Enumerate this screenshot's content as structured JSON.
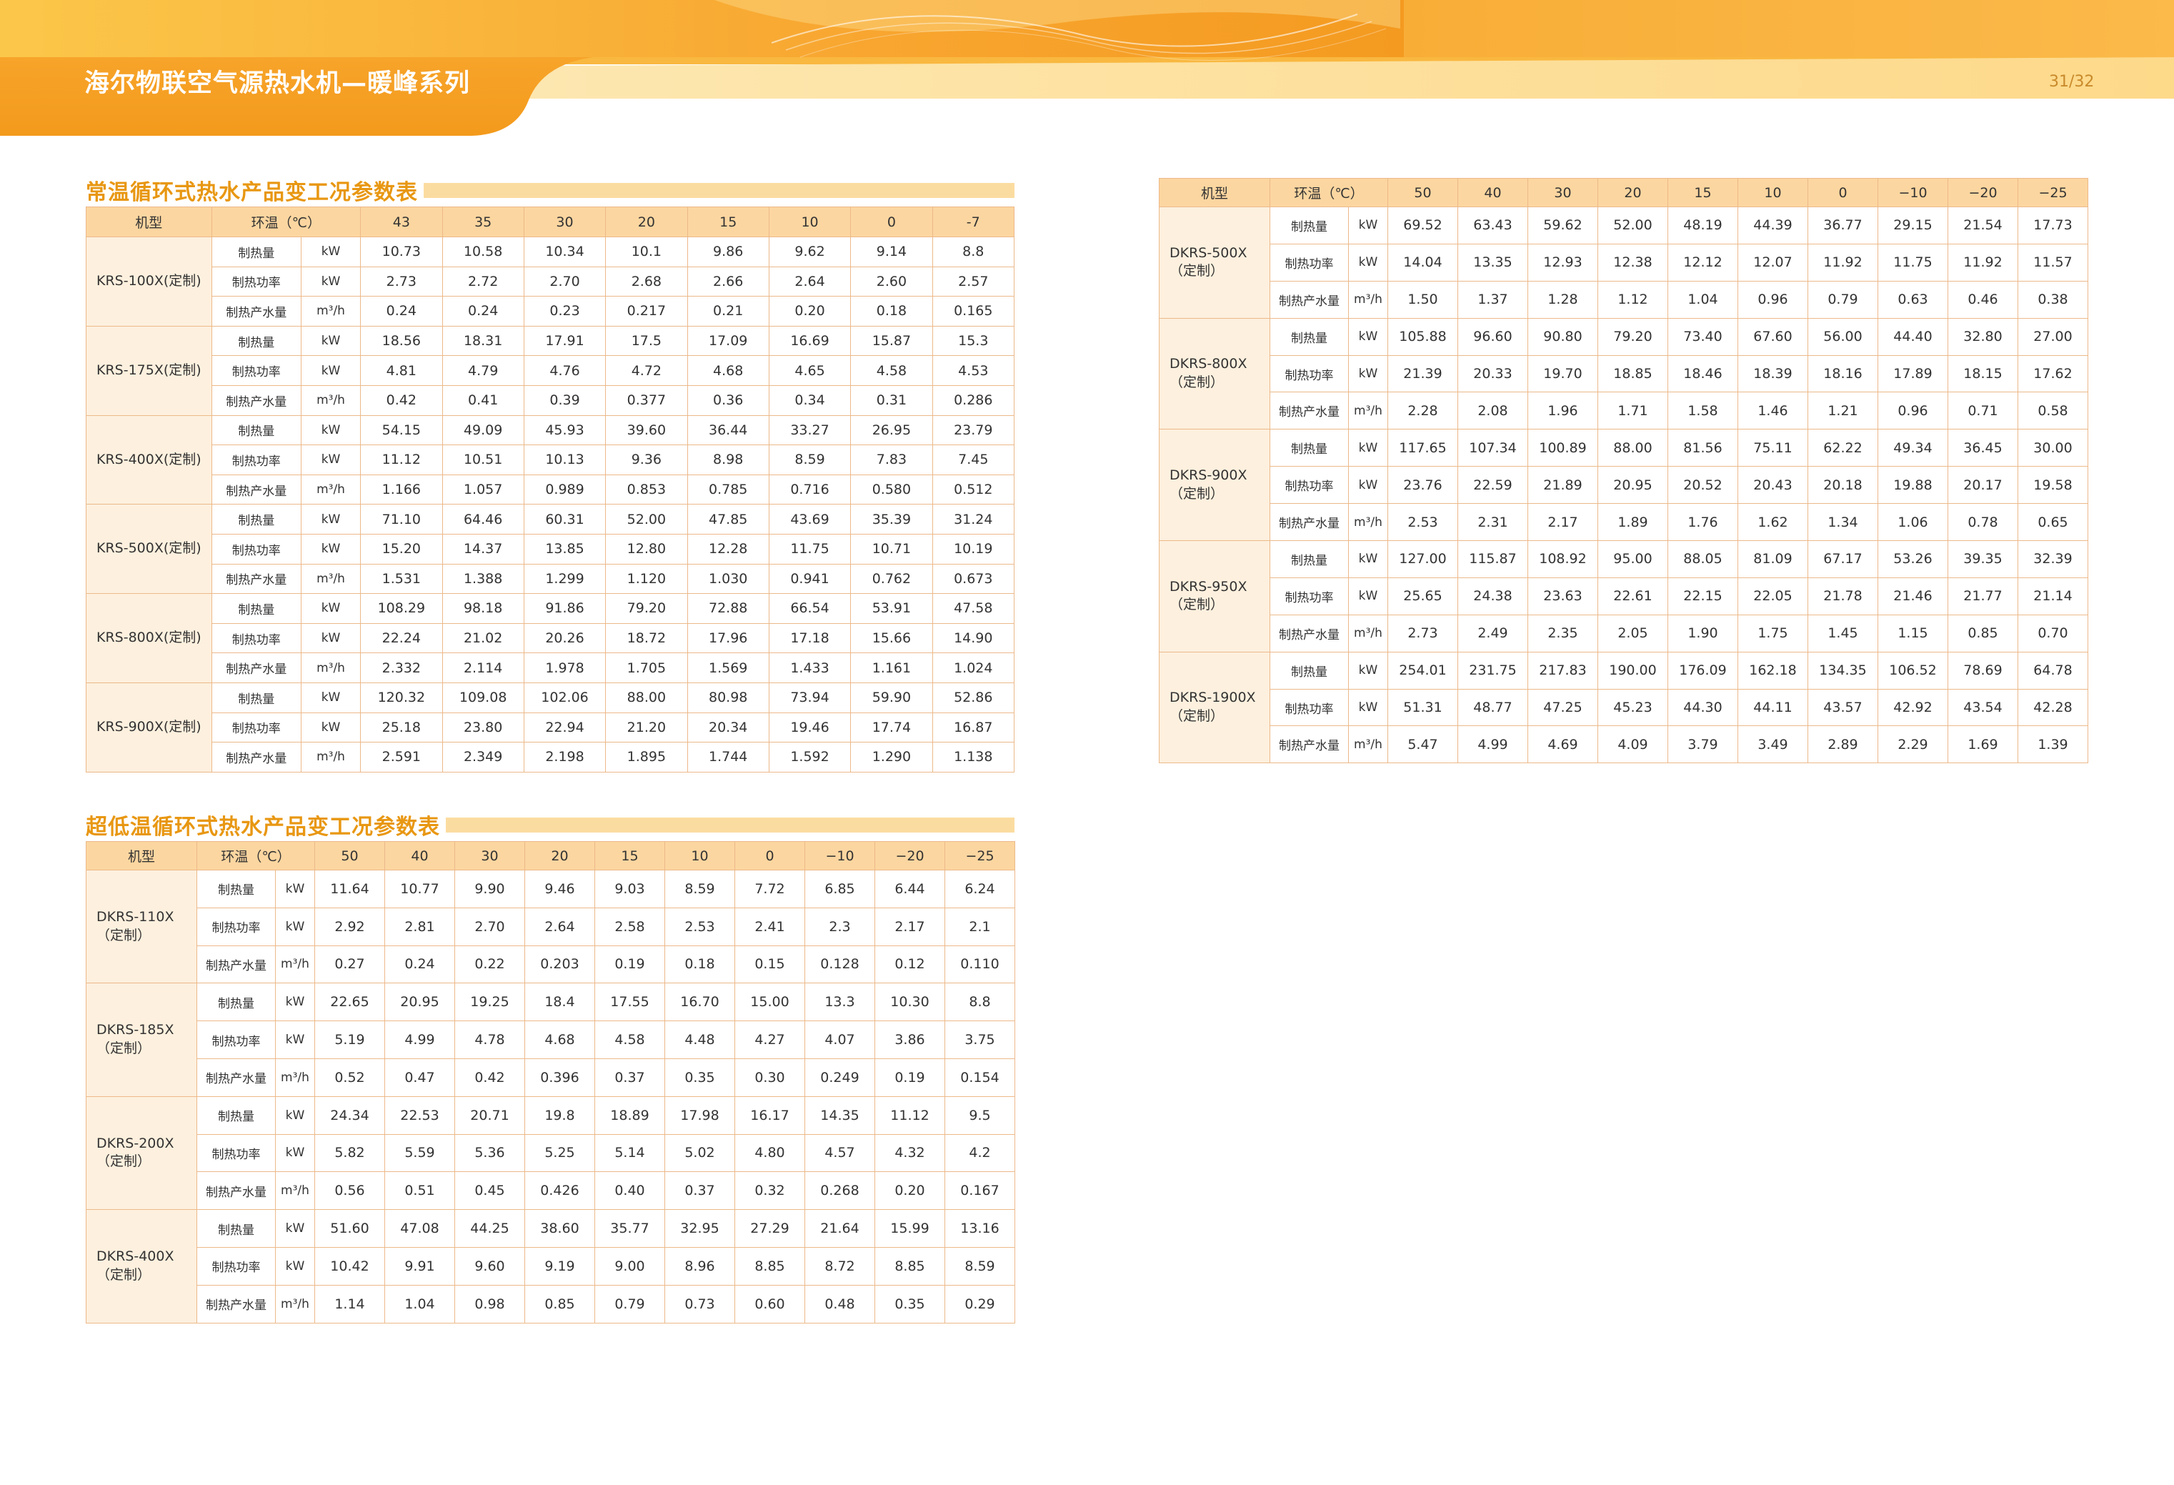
{
  "header": {
    "title": "海尔物联空气源热水机—暖峰系列",
    "page_number": "31/32"
  },
  "sections": {
    "normal_title": "常温循环式热水产品变工况参数表",
    "low_title": "超低温循环式热水产品变工况参数表"
  },
  "tables": {
    "normal": {
      "header_model": "机型",
      "header_ambient": "环温（℃）",
      "temps": [
        "43",
        "35",
        "30",
        "20",
        "15",
        "10",
        "0",
        "-7"
      ],
      "models": [
        {
          "name": "KRS-100X(定制)",
          "rows": [
            {
              "param": "制热量",
              "unit": "kW",
              "values": [
                "10.73",
                "10.58",
                "10.34",
                "10.1",
                "9.86",
                "9.62",
                "9.14",
                "8.8"
              ]
            },
            {
              "param": "制热功率",
              "unit": "kW",
              "values": [
                "2.73",
                "2.72",
                "2.70",
                "2.68",
                "2.66",
                "2.64",
                "2.60",
                "2.57"
              ]
            },
            {
              "param": "制热产水量",
              "unit": "m³/h",
              "values": [
                "0.24",
                "0.24",
                "0.23",
                "0.217",
                "0.21",
                "0.20",
                "0.18",
                "0.165"
              ]
            }
          ]
        },
        {
          "name": "KRS-175X(定制)",
          "rows": [
            {
              "param": "制热量",
              "unit": "kW",
              "values": [
                "18.56",
                "18.31",
                "17.91",
                "17.5",
                "17.09",
                "16.69",
                "15.87",
                "15.3"
              ]
            },
            {
              "param": "制热功率",
              "unit": "kW",
              "values": [
                "4.81",
                "4.79",
                "4.76",
                "4.72",
                "4.68",
                "4.65",
                "4.58",
                "4.53"
              ]
            },
            {
              "param": "制热产水量",
              "unit": "m³/h",
              "values": [
                "0.42",
                "0.41",
                "0.39",
                "0.377",
                "0.36",
                "0.34",
                "0.31",
                "0.286"
              ]
            }
          ]
        },
        {
          "name": "KRS-400X(定制)",
          "rows": [
            {
              "param": "制热量",
              "unit": "kW",
              "values": [
                "54.15",
                "49.09",
                "45.93",
                "39.60",
                "36.44",
                "33.27",
                "26.95",
                "23.79"
              ]
            },
            {
              "param": "制热功率",
              "unit": "kW",
              "values": [
                "11.12",
                "10.51",
                "10.13",
                "9.36",
                "8.98",
                "8.59",
                "7.83",
                "7.45"
              ]
            },
            {
              "param": "制热产水量",
              "unit": "m³/h",
              "values": [
                "1.166",
                "1.057",
                "0.989",
                "0.853",
                "0.785",
                "0.716",
                "0.580",
                "0.512"
              ]
            }
          ]
        },
        {
          "name": "KRS-500X(定制)",
          "rows": [
            {
              "param": "制热量",
              "unit": "kW",
              "values": [
                "71.10",
                "64.46",
                "60.31",
                "52.00",
                "47.85",
                "43.69",
                "35.39",
                "31.24"
              ]
            },
            {
              "param": "制热功率",
              "unit": "kW",
              "values": [
                "15.20",
                "14.37",
                "13.85",
                "12.80",
                "12.28",
                "11.75",
                "10.71",
                "10.19"
              ]
            },
            {
              "param": "制热产水量",
              "unit": "m³/h",
              "values": [
                "1.531",
                "1.388",
                "1.299",
                "1.120",
                "1.030",
                "0.941",
                "0.762",
                "0.673"
              ]
            }
          ]
        },
        {
          "name": "KRS-800X(定制)",
          "rows": [
            {
              "param": "制热量",
              "unit": "kW",
              "values": [
                "108.29",
                "98.18",
                "91.86",
                "79.20",
                "72.88",
                "66.54",
                "53.91",
                "47.58"
              ]
            },
            {
              "param": "制热功率",
              "unit": "kW",
              "values": [
                "22.24",
                "21.02",
                "20.26",
                "18.72",
                "17.96",
                "17.18",
                "15.66",
                "14.90"
              ]
            },
            {
              "param": "制热产水量",
              "unit": "m³/h",
              "values": [
                "2.332",
                "2.114",
                "1.978",
                "1.705",
                "1.569",
                "1.433",
                "1.161",
                "1.024"
              ]
            }
          ]
        },
        {
          "name": "KRS-900X(定制)",
          "rows": [
            {
              "param": "制热量",
              "unit": "kW",
              "values": [
                "120.32",
                "109.08",
                "102.06",
                "88.00",
                "80.98",
                "73.94",
                "59.90",
                "52.86"
              ]
            },
            {
              "param": "制热功率",
              "unit": "kW",
              "values": [
                "25.18",
                "23.80",
                "22.94",
                "21.20",
                "20.34",
                "19.46",
                "17.74",
                "16.87"
              ]
            },
            {
              "param": "制热产水量",
              "unit": "m³/h",
              "values": [
                "2.591",
                "2.349",
                "2.198",
                "1.895",
                "1.744",
                "1.592",
                "1.290",
                "1.138"
              ]
            }
          ]
        }
      ]
    },
    "low_left": {
      "header_model": "机型",
      "header_ambient": "环温（℃）",
      "temps": [
        "50",
        "40",
        "30",
        "20",
        "15",
        "10",
        "0",
        "−10",
        "−20",
        "−25"
      ],
      "models": [
        {
          "name": "DKRS-110X（定制）",
          "rows": [
            {
              "param": "制热量",
              "unit": "kW",
              "values": [
                "11.64",
                "10.77",
                "9.90",
                "9.46",
                "9.03",
                "8.59",
                "7.72",
                "6.85",
                "6.44",
                "6.24"
              ]
            },
            {
              "param": "制热功率",
              "unit": "kW",
              "values": [
                "2.92",
                "2.81",
                "2.70",
                "2.64",
                "2.58",
                "2.53",
                "2.41",
                "2.3",
                "2.17",
                "2.1"
              ]
            },
            {
              "param": "制热产水量",
              "unit": "m³/h",
              "values": [
                "0.27",
                "0.24",
                "0.22",
                "0.203",
                "0.19",
                "0.18",
                "0.15",
                "0.128",
                "0.12",
                "0.110"
              ]
            }
          ]
        },
        {
          "name": "DKRS-185X（定制）",
          "rows": [
            {
              "param": "制热量",
              "unit": "kW",
              "values": [
                "22.65",
                "20.95",
                "19.25",
                "18.4",
                "17.55",
                "16.70",
                "15.00",
                "13.3",
                "10.30",
                "8.8"
              ]
            },
            {
              "param": "制热功率",
              "unit": "kW",
              "values": [
                "5.19",
                "4.99",
                "4.78",
                "4.68",
                "4.58",
                "4.48",
                "4.27",
                "4.07",
                "3.86",
                "3.75"
              ]
            },
            {
              "param": "制热产水量",
              "unit": "m³/h",
              "values": [
                "0.52",
                "0.47",
                "0.42",
                "0.396",
                "0.37",
                "0.35",
                "0.30",
                "0.249",
                "0.19",
                "0.154"
              ]
            }
          ]
        },
        {
          "name": "DKRS-200X（定制）",
          "rows": [
            {
              "param": "制热量",
              "unit": "kW",
              "values": [
                "24.34",
                "22.53",
                "20.71",
                "19.8",
                "18.89",
                "17.98",
                "16.17",
                "14.35",
                "11.12",
                "9.5"
              ]
            },
            {
              "param": "制热功率",
              "unit": "kW",
              "values": [
                "5.82",
                "5.59",
                "5.36",
                "5.25",
                "5.14",
                "5.02",
                "4.80",
                "4.57",
                "4.32",
                "4.2"
              ]
            },
            {
              "param": "制热产水量",
              "unit": "m³/h",
              "values": [
                "0.56",
                "0.51",
                "0.45",
                "0.426",
                "0.40",
                "0.37",
                "0.32",
                "0.268",
                "0.20",
                "0.167"
              ]
            }
          ]
        },
        {
          "name": "DKRS-400X（定制）",
          "rows": [
            {
              "param": "制热量",
              "unit": "kW",
              "values": [
                "51.60",
                "47.08",
                "44.25",
                "38.60",
                "35.77",
                "32.95",
                "27.29",
                "21.64",
                "15.99",
                "13.16"
              ]
            },
            {
              "param": "制热功率",
              "unit": "kW",
              "values": [
                "10.42",
                "9.91",
                "9.60",
                "9.19",
                "9.00",
                "8.96",
                "8.85",
                "8.72",
                "8.85",
                "8.59"
              ]
            },
            {
              "param": "制热产水量",
              "unit": "m³/h",
              "values": [
                "1.14",
                "1.04",
                "0.98",
                "0.85",
                "0.79",
                "0.73",
                "0.60",
                "0.48",
                "0.35",
                "0.29"
              ]
            }
          ]
        }
      ]
    },
    "low_right": {
      "header_model": "机型",
      "header_ambient": "环温（℃）",
      "temps": [
        "50",
        "40",
        "30",
        "20",
        "15",
        "10",
        "0",
        "−10",
        "−20",
        "−25"
      ],
      "models": [
        {
          "name": "DKRS-500X（定制）",
          "rows": [
            {
              "param": "制热量",
              "unit": "kW",
              "values": [
                "69.52",
                "63.43",
                "59.62",
                "52.00",
                "48.19",
                "44.39",
                "36.77",
                "29.15",
                "21.54",
                "17.73"
              ]
            },
            {
              "param": "制热功率",
              "unit": "kW",
              "values": [
                "14.04",
                "13.35",
                "12.93",
                "12.38",
                "12.12",
                "12.07",
                "11.92",
                "11.75",
                "11.92",
                "11.57"
              ]
            },
            {
              "param": "制热产水量",
              "unit": "m³/h",
              "values": [
                "1.50",
                "1.37",
                "1.28",
                "1.12",
                "1.04",
                "0.96",
                "0.79",
                "0.63",
                "0.46",
                "0.38"
              ]
            }
          ]
        },
        {
          "name": "DKRS-800X（定制）",
          "rows": [
            {
              "param": "制热量",
              "unit": "kW",
              "values": [
                "105.88",
                "96.60",
                "90.80",
                "79.20",
                "73.40",
                "67.60",
                "56.00",
                "44.40",
                "32.80",
                "27.00"
              ]
            },
            {
              "param": "制热功率",
              "unit": "kW",
              "values": [
                "21.39",
                "20.33",
                "19.70",
                "18.85",
                "18.46",
                "18.39",
                "18.16",
                "17.89",
                "18.15",
                "17.62"
              ]
            },
            {
              "param": "制热产水量",
              "unit": "m³/h",
              "values": [
                "2.28",
                "2.08",
                "1.96",
                "1.71",
                "1.58",
                "1.46",
                "1.21",
                "0.96",
                "0.71",
                "0.58"
              ]
            }
          ]
        },
        {
          "name": "DKRS-900X（定制）",
          "rows": [
            {
              "param": "制热量",
              "unit": "kW",
              "values": [
                "117.65",
                "107.34",
                "100.89",
                "88.00",
                "81.56",
                "75.11",
                "62.22",
                "49.34",
                "36.45",
                "30.00"
              ]
            },
            {
              "param": "制热功率",
              "unit": "kW",
              "values": [
                "23.76",
                "22.59",
                "21.89",
                "20.95",
                "20.52",
                "20.43",
                "20.18",
                "19.88",
                "20.17",
                "19.58"
              ]
            },
            {
              "param": "制热产水量",
              "unit": "m³/h",
              "values": [
                "2.53",
                "2.31",
                "2.17",
                "1.89",
                "1.76",
                "1.62",
                "1.34",
                "1.06",
                "0.78",
                "0.65"
              ]
            }
          ]
        },
        {
          "name": "DKRS-950X（定制）",
          "rows": [
            {
              "param": "制热量",
              "unit": "kW",
              "values": [
                "127.00",
                "115.87",
                "108.92",
                "95.00",
                "88.05",
                "81.09",
                "67.17",
                "53.26",
                "39.35",
                "32.39"
              ]
            },
            {
              "param": "制热功率",
              "unit": "kW",
              "values": [
                "25.65",
                "24.38",
                "23.63",
                "22.61",
                "22.15",
                "22.05",
                "21.78",
                "21.46",
                "21.77",
                "21.14"
              ]
            },
            {
              "param": "制热产水量",
              "unit": "m³/h",
              "values": [
                "2.73",
                "2.49",
                "2.35",
                "2.05",
                "1.90",
                "1.75",
                "1.45",
                "1.15",
                "0.85",
                "0.70"
              ]
            }
          ]
        },
        {
          "name": "DKRS-1900X（定制）",
          "rows": [
            {
              "param": "制热量",
              "unit": "kW",
              "values": [
                "254.01",
                "231.75",
                "217.83",
                "190.00",
                "176.09",
                "162.18",
                "134.35",
                "106.52",
                "78.69",
                "64.78"
              ]
            },
            {
              "param": "制热功率",
              "unit": "kW",
              "values": [
                "51.31",
                "48.77",
                "47.25",
                "45.23",
                "44.30",
                "44.11",
                "43.57",
                "42.92",
                "43.54",
                "42.28"
              ]
            },
            {
              "param": "制热产水量",
              "unit": "m³/h",
              "values": [
                "5.47",
                "4.99",
                "4.69",
                "4.09",
                "3.79",
                "3.49",
                "2.89",
                "2.29",
                "1.69",
                "1.39"
              ]
            }
          ]
        }
      ]
    }
  }
}
